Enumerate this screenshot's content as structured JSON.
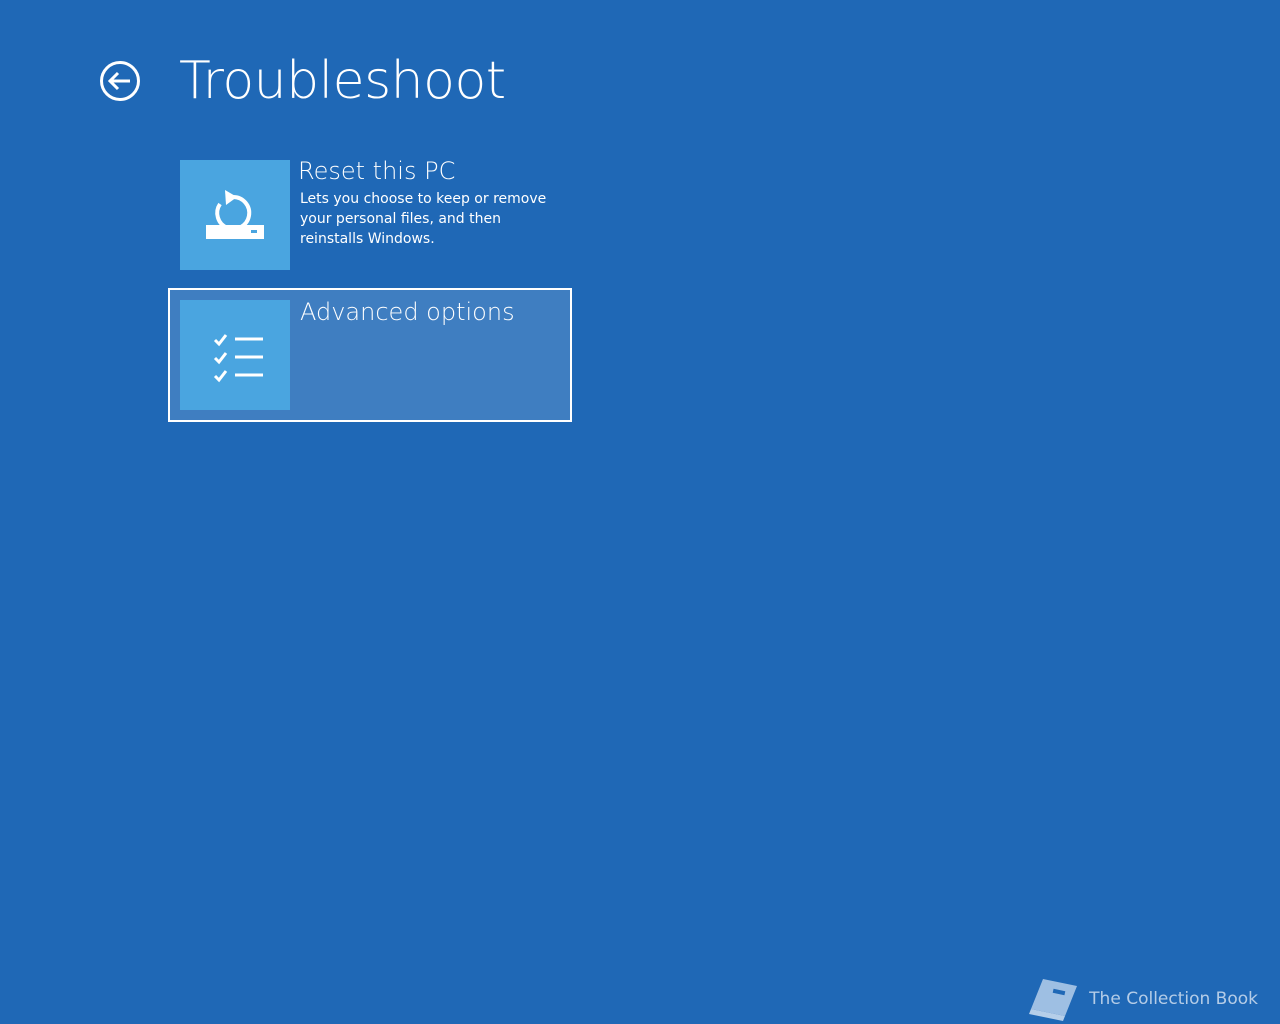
{
  "header": {
    "title": "Troubleshoot",
    "back_icon": "back-arrow-circle-icon"
  },
  "options": [
    {
      "title": "Reset this PC",
      "description": "Lets you choose to keep or remove your personal files, and then reinstalls Windows.",
      "icon": "reset-pc-icon"
    },
    {
      "title": "Advanced options",
      "icon": "checklist-icon",
      "selected": true
    }
  ],
  "watermark": {
    "text": "The Collection Book",
    "icon": "book-icon"
  },
  "colors": {
    "background": "#1f68b6",
    "tile": "#4aa5e0",
    "selected_background": "#3f7ec1",
    "text": "#ffffff"
  }
}
